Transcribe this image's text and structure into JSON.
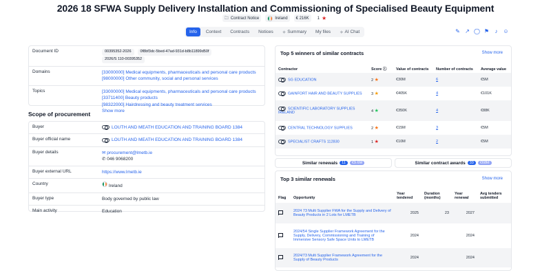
{
  "header": {
    "title": "2026 18 SFWA Supply Delivery Installation and Commissioning of Specialised Beauty Equipment",
    "notice_type": "Contract Notice",
    "country": "Ireland",
    "value": "€ 216K",
    "rating": "1"
  },
  "tabs": [
    {
      "label": "Info",
      "icon": ""
    },
    {
      "label": "Context",
      "icon": ""
    },
    {
      "label": "Contracts",
      "icon": ""
    },
    {
      "label": "Notices",
      "icon": ""
    },
    {
      "label": "Summary",
      "icon": "sparkle-icon"
    },
    {
      "label": "My files",
      "icon": ""
    },
    {
      "label": "AI Chat",
      "icon": "sparkle-icon"
    }
  ],
  "info": {
    "document_id_label": "Document ID",
    "document_ids": [
      "00395352-2026",
      "0f8bf3dc-5bed-47ad-931d-b8b11899d50f",
      "2026/S 110-00395352"
    ],
    "domains_label": "Domains",
    "domains": [
      "[33000000] Medical equipments, pharmaceuticals and personal care products",
      "[98000000] Other community, social and personal services"
    ],
    "topics_label": "Topics",
    "topics": [
      "[33000000] Medical equipments, pharmaceuticals and personal care products",
      "[33711400] Beauty products",
      "[98322000] Hairdressing and beauty treatment services"
    ],
    "show_more": "Show more"
  },
  "scope": {
    "heading": "Scope of procurement",
    "buyer_label": "Buyer",
    "buyer": "LOUTH AND MEATH EDUCATION AND TRAINING BOARD 1384",
    "buyer_official_label": "Buyer official name",
    "buyer_official": "LOUTH AND MEATH EDUCATION AND TRAINING BOARD 1384",
    "buyer_details_label": "Buyer details",
    "email": "procurement@lmetb.ie",
    "phone": "046 9068200",
    "url_label": "Buyer external URL",
    "url": "https://www.lmetb.ie",
    "country_label": "Country",
    "country": "Ireland",
    "type_label": "Buyer type",
    "type": "Body governed by public law",
    "activity_label": "Main activity",
    "activity": "Education"
  },
  "winners": {
    "title": "Top 5 winners of similar contracts",
    "show_more": "Show more",
    "columns": [
      "Contractor",
      "Score",
      "Value of contracts",
      "Number of contracts",
      "Average value"
    ],
    "rows": [
      {
        "name": "SG EDUCATION",
        "score": "2",
        "star_color": "#f97316",
        "value": "€30M",
        "count": "6",
        "avg": "€5M"
      },
      {
        "name": "GAINFORT HAIR AND BEAUTY SUPPLIES",
        "score": "3",
        "star_color": "#f59e0b",
        "value": "€405K",
        "count": "4",
        "avg": "€101K"
      },
      {
        "name": "SCIENTIFIC LABORATORY SUPPLIES IRELAND",
        "score": "4",
        "star_color": "#22c55e",
        "value": "€350K",
        "count": "4",
        "avg": "€88K"
      },
      {
        "name": "CENTRAL TECHNOLOGY SUPPLIES",
        "score": "2",
        "star_color": "#f97316",
        "value": "€15M",
        "count": "3",
        "avg": "€5M"
      },
      {
        "name": "SPECIALIST CRAFTS 112830",
        "score": "1",
        "star_color": "#dc2626",
        "value": "€10M",
        "count": "2",
        "avg": "€5M"
      }
    ]
  },
  "similar": {
    "renewals_label": "Similar renewals",
    "renewals_count": "11",
    "renewals_amount": "€9.6M",
    "awards_label": "Similar contract awards",
    "awards_count": "33",
    "awards_amount": "€68M"
  },
  "renewals": {
    "title": "Top 3 similar renewals",
    "show_more": "Show more",
    "columns": [
      "Flag",
      "Opportunity",
      "Year tendered",
      "Duration (months)",
      "Year renewal",
      "Avg tenders submitted"
    ],
    "rows": [
      {
        "opportunity": "2024 73 Multi Supplier FWA for the Supply and Delivery of Beauty Products in 2 Lots for LMETB",
        "year": "2025",
        "duration": "23",
        "renewal": "2027",
        "avg": ""
      },
      {
        "opportunity": "2024/54 Single Supplier Framework Agreement for the Supply, Delivery, Commissioning and Training of Immersive Sensory Safe Space Units to LMETB",
        "year": "2024",
        "duration": "",
        "renewal": "2024",
        "avg": ""
      },
      {
        "opportunity": "2024/73 Multi Supplier Framework Agreement for the Supply of Beauty Products",
        "year": "2024",
        "duration": "",
        "renewal": "2024",
        "avg": ""
      }
    ]
  }
}
